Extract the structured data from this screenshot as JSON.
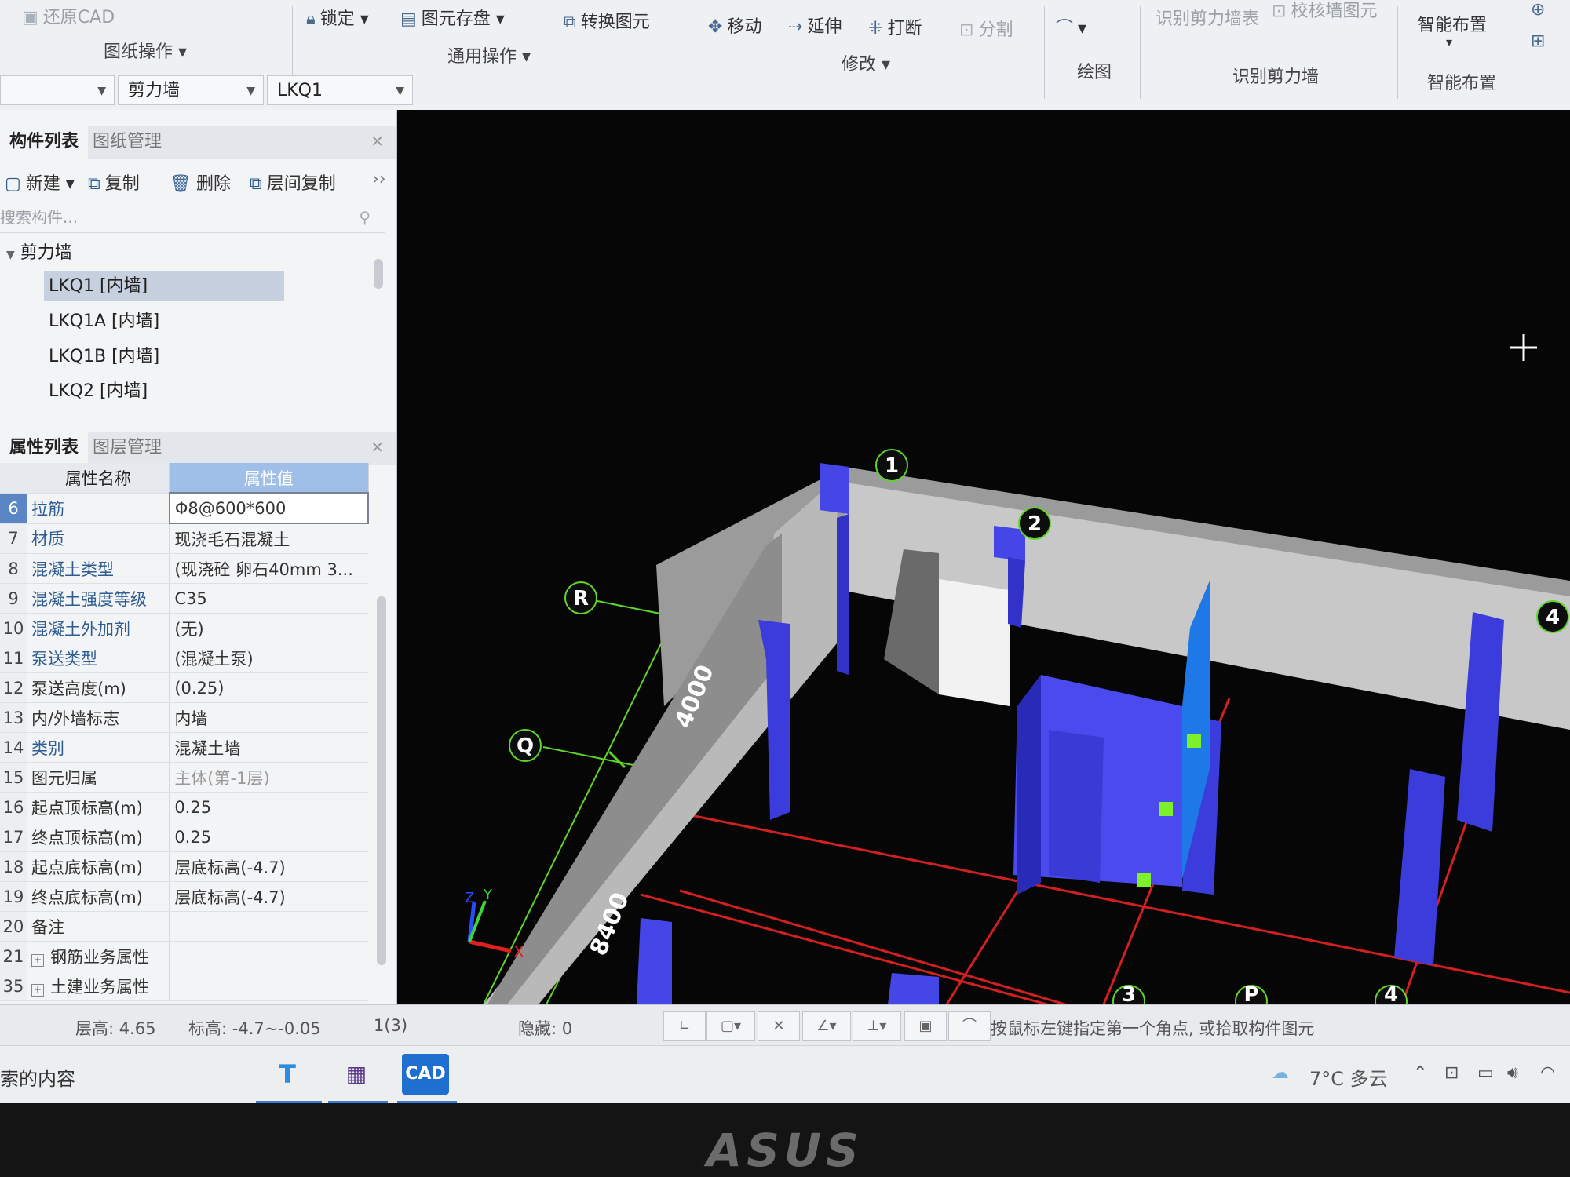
{
  "ribbon": {
    "restore_cad": "还原CAD",
    "lock": "锁定",
    "element_save": "图元存盘",
    "convert_element": "转换图元",
    "move": "移动",
    "extend": "延伸",
    "break": "打断",
    "split": "分割",
    "identify_wall_table": "识别剪力墙表",
    "check_wall_element": "校核墙图元",
    "smart_layout": "智能布置",
    "groups": {
      "drawing_ops": "图纸操作",
      "common_ops": "通用操作",
      "modify": "修改",
      "draw": "绘图",
      "identify_wall": "识别剪力墙",
      "smart_layout": "智能布置"
    }
  },
  "selectors": {
    "category": "剪力墙",
    "component": "LKQ1"
  },
  "component_panel": {
    "tab_active": "构件列表",
    "tab_other": "图纸管理",
    "toolbar": {
      "new": "新建",
      "copy": "复制",
      "delete": "删除",
      "floor_copy": "层间复制"
    },
    "search_placeholder": "搜索构件...",
    "tree_root": "剪力墙",
    "items": [
      "LKQ1 [内墙]",
      "LKQ1A [内墙]",
      "LKQ1B [内墙]",
      "LKQ2 [内墙]"
    ]
  },
  "property_panel": {
    "tab_active": "属性列表",
    "tab_other": "图层管理",
    "header_name": "属性名称",
    "header_value": "属性值",
    "rows": [
      {
        "no": "6",
        "name": "拉筋",
        "value": "Φ8@600*600"
      },
      {
        "no": "7",
        "name": "材质",
        "value": "现浇毛石混凝土"
      },
      {
        "no": "8",
        "name": "混凝土类型",
        "value": "(现浇砼 卵石40mm 3..."
      },
      {
        "no": "9",
        "name": "混凝土强度等级",
        "value": "C35"
      },
      {
        "no": "10",
        "name": "混凝土外加剂",
        "value": "(无)"
      },
      {
        "no": "11",
        "name": "泵送类型",
        "value": "(混凝土泵)"
      },
      {
        "no": "12",
        "name": "泵送高度(m)",
        "value": "(0.25)"
      },
      {
        "no": "13",
        "name": "内/外墙标志",
        "value": "内墙"
      },
      {
        "no": "14",
        "name": "类别",
        "value": "混凝土墙"
      },
      {
        "no": "15",
        "name": "图元归属",
        "value": "主体(第-1层)"
      },
      {
        "no": "16",
        "name": "起点顶标高(m)",
        "value": "0.25"
      },
      {
        "no": "17",
        "name": "终点顶标高(m)",
        "value": "0.25"
      },
      {
        "no": "18",
        "name": "起点底标高(m)",
        "value": "层底标高(-4.7)"
      },
      {
        "no": "19",
        "name": "终点底标高(m)",
        "value": "层底标高(-4.7)"
      },
      {
        "no": "20",
        "name": "备注",
        "value": ""
      },
      {
        "no": "21",
        "name": "钢筋业务属性",
        "value": ""
      },
      {
        "no": "35",
        "name": "土建业务属性",
        "value": ""
      }
    ]
  },
  "viewport": {
    "axis_labels": {
      "a1": "1",
      "a2": "2",
      "a4": "4",
      "a3": "3",
      "aP": "P",
      "a4b": "4",
      "aR": "R",
      "aQ": "Q"
    },
    "dims": {
      "d1": "4000",
      "d2": "8400"
    },
    "axes_gizmo": {
      "x": "X",
      "y": "Y",
      "z": "Z"
    }
  },
  "status": {
    "floor_height": "层高: 4.65",
    "elevation": "标高: -4.7~-0.05",
    "page": "1(3)",
    "hidden": "隐藏: 0",
    "hint": "按鼠标左键指定第一个角点, 或拾取构件图元"
  },
  "taskbar": {
    "search_text": "索的内容",
    "weather": "7°C 多云",
    "app_badge": "CAD"
  },
  "bezel": {
    "brand": "ASUS"
  }
}
